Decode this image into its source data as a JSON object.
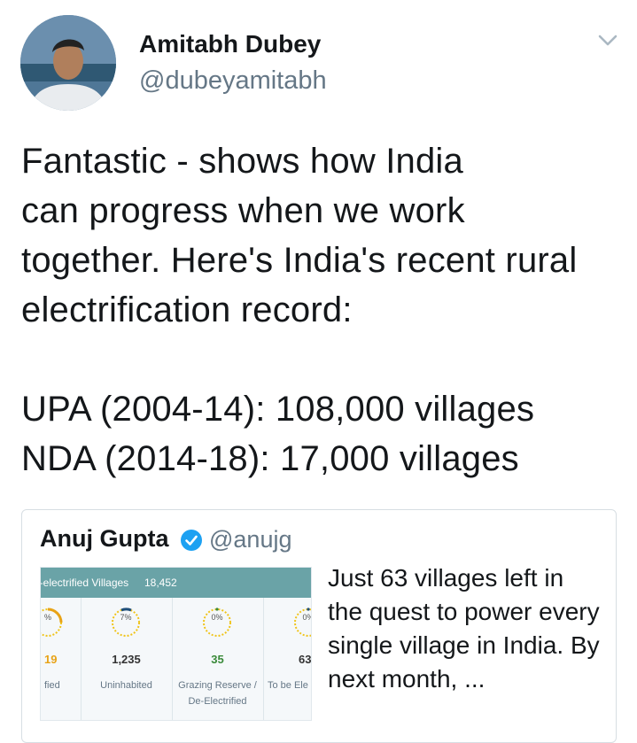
{
  "author": {
    "name": "Amitabh Dubey",
    "handle": "@dubeyamitabh"
  },
  "tweet": {
    "text": "Fantastic - shows how India\ncan progress when we work\ntogether. Here's India's recent rural\nelectrification record:\n\nUPA (2004-14): 108,000 villages\nNDA (2014-18): 17,000 villages"
  },
  "icons": {
    "menu": "chevron-down-icon",
    "verified": "verified-badge-icon"
  },
  "quote": {
    "name": "Anuj Gupta",
    "handle": "@anujg",
    "text": "Just 63 villages left in the quest to power every single village in India. By next month, ...",
    "card": {
      "header_label": "n-electrified Villages",
      "header_count": "18,452",
      "stats": [
        {
          "pct": "%",
          "value": "19",
          "label": "fied",
          "color": "#e8a317"
        },
        {
          "pct": "7%",
          "value": "1,235",
          "label": "Uninhabited",
          "color": "#333333"
        },
        {
          "pct": "0%",
          "value": "35",
          "label": "Grazing Reserve /\nDe-Electrified",
          "color": "#3a8a3a"
        },
        {
          "pct": "0%",
          "value": "63",
          "label": "To be Ele",
          "color": "#333333"
        }
      ]
    }
  },
  "colors": {
    "accent": "#1da1f2",
    "card_header": "#6aa3a7",
    "gauge": "#f0c419"
  }
}
